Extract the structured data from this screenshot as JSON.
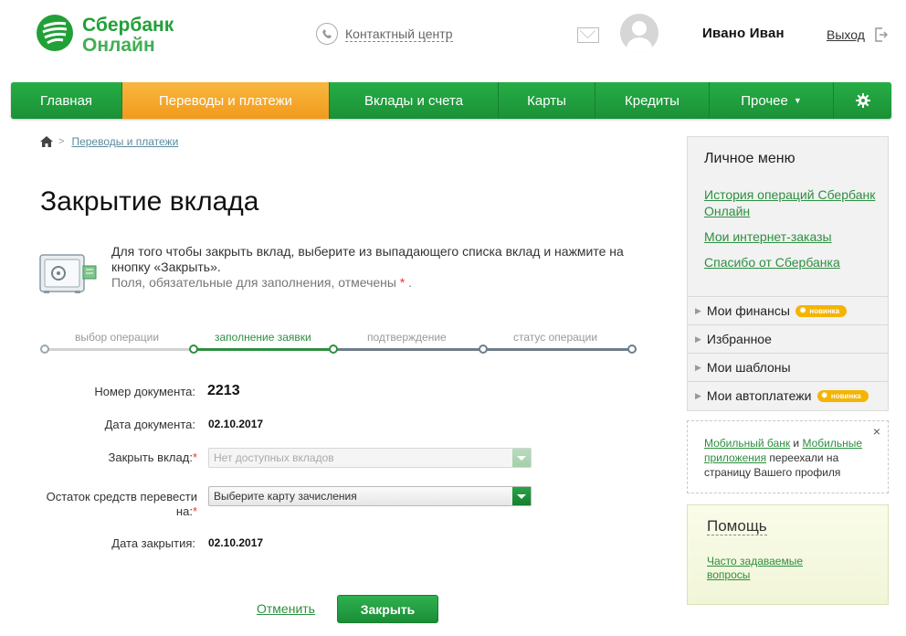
{
  "header": {
    "logo_line1": "Сбербанк",
    "logo_line2": "Онлайн",
    "contact_center": "Контактный центр",
    "user_name": "Ивано Иван",
    "logout": "Выход"
  },
  "nav": {
    "items": [
      {
        "label": "Главная"
      },
      {
        "label": "Переводы и платежи",
        "active": true
      },
      {
        "label": "Вклады и счета"
      },
      {
        "label": "Карты"
      },
      {
        "label": "Кредиты"
      },
      {
        "label": "Прочее"
      }
    ],
    "settings_icon": "gear-icon"
  },
  "breadcrumb": {
    "home_icon": "home-icon",
    "link": "Переводы и платежи"
  },
  "page": {
    "title": "Закрытие вклада",
    "info_line1": "Для того чтобы закрыть вклад, выберите из выпадающего списка вклад и нажмите на кнопку «Закрыть».",
    "info_note": "Поля, обязательные для заполнения, отмечены",
    "required_mark": "*",
    "info_note_end": "."
  },
  "stepper": {
    "steps": [
      {
        "label": "выбор операции",
        "state": "done"
      },
      {
        "label": "заполнение заявки",
        "state": "current"
      },
      {
        "label": "подтверждение",
        "state": "pending"
      },
      {
        "label": "статус операции",
        "state": "pending"
      }
    ]
  },
  "form": {
    "doc_number_label": "Номер документа:",
    "doc_number_value": "2213",
    "doc_date_label": "Дата документа:",
    "doc_date_value": "02.10.2017",
    "close_deposit_label": "Закрыть вклад:",
    "close_deposit_value": "Нет доступных вкладов",
    "transfer_label_line1": "Остаток средств перевести",
    "transfer_label_line2": "на:",
    "transfer_value": "Выберите карту зачисления",
    "close_date_label": "Дата закрытия:",
    "close_date_value": "02.10.2017",
    "required_mark": "*",
    "cancel_label": "Отменить",
    "submit_label": "Закрыть"
  },
  "sidebar": {
    "title": "Личное меню",
    "links": [
      "История операций Сбербанк Онлайн",
      "Мои интернет-заказы",
      "Спасибо от Сбербанка"
    ],
    "rows": [
      {
        "label": "Мои финансы",
        "badge": "новинка"
      },
      {
        "label": "Избранное"
      },
      {
        "label": "Мои шаблоны"
      },
      {
        "label": "Мои автоплатежи",
        "badge": "новинка"
      }
    ]
  },
  "notice": {
    "link1": "Мобильный банк",
    "and": " и ",
    "link2": "Мобильные приложения",
    "rest": " переехали на страницу Вашего профиля",
    "close": "×"
  },
  "help": {
    "title": "Помощь",
    "faq": "Часто задаваемые вопросы"
  },
  "colors": {
    "brand_green": "#21a038",
    "nav_active": "#f29a1c",
    "link_green": "#2c8f3f"
  }
}
